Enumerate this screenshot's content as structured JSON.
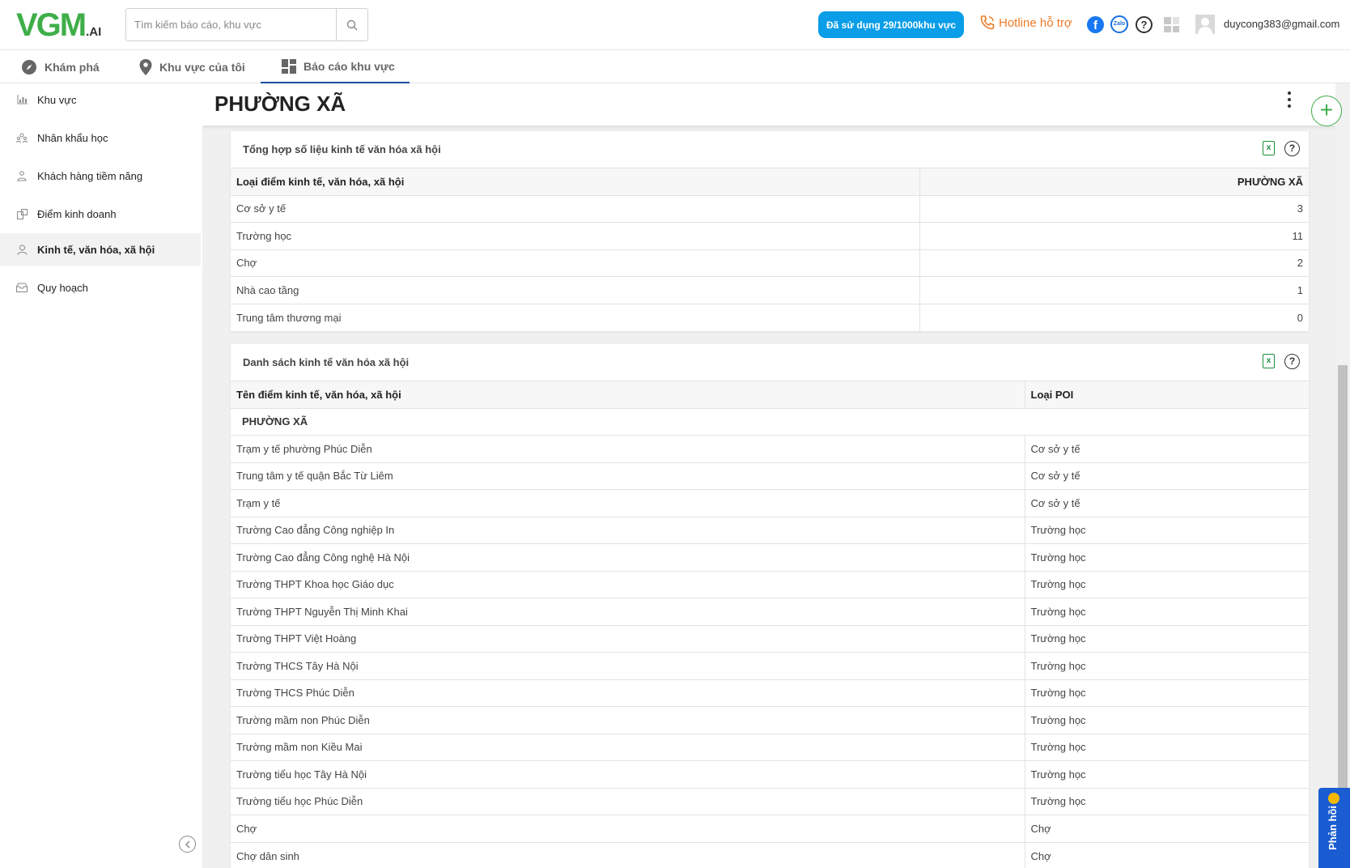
{
  "header": {
    "logo_text": "VGM",
    "logo_suffix": ".AI",
    "search_placeholder": "Tìm kiếm báo cáo, khu vực",
    "usage_badge": "Đã sử dụng 29/1000khu vực",
    "hotline": "Hotline hỗ trợ",
    "zalo_label": "Zalo",
    "help_glyph": "?",
    "user_email": "duycong383@gmail.com"
  },
  "nav": {
    "tabs": [
      {
        "label": "Khám phá",
        "icon": "compass-icon"
      },
      {
        "label": "Khu vực của tôi",
        "icon": "map-pin-icon"
      },
      {
        "label": "Báo cáo khu vực",
        "icon": "dashboard-icon",
        "active": true
      }
    ]
  },
  "sidebar": {
    "items": [
      {
        "label": "Khu vực",
        "icon": "bar-chart-icon"
      },
      {
        "label": "Nhân khẩu học",
        "icon": "people-icon"
      },
      {
        "label": "Khách hàng tiềm năng",
        "icon": "customer-icon"
      },
      {
        "label": "Điểm kinh doanh",
        "icon": "store-icon"
      },
      {
        "label": "Kinh tế, văn hóa, xã hội",
        "icon": "culture-icon",
        "active": true
      },
      {
        "label": "Quy hoạch",
        "icon": "planning-icon"
      }
    ]
  },
  "main": {
    "page_title": "PHƯỜNG XÃ",
    "summary": {
      "title": "Tổng hợp số liệu kinh tế văn hóa xã hội",
      "col_type": "Loại điểm kinh tế, văn hóa, xã hội",
      "col_area": "PHƯỜNG XÃ",
      "rows": [
        {
          "type": "Cơ sở y tế",
          "value": "3"
        },
        {
          "type": "Trường học",
          "value": "11"
        },
        {
          "type": "Chợ",
          "value": "2"
        },
        {
          "type": "Nhà cao tầng",
          "value": "1"
        },
        {
          "type": "Trung tâm thương mại",
          "value": "0"
        }
      ]
    },
    "list": {
      "title": "Danh sách kinh tế văn hóa xã hội",
      "col_name": "Tên điểm kinh tế, văn hóa, xã hội",
      "col_poi": "Loại POI",
      "group": "PHƯỜNG XÃ",
      "rows": [
        {
          "name": "Trạm y tế phường Phúc Diễn",
          "poi": "Cơ sở y tế"
        },
        {
          "name": "Trung tâm y tế quận Bắc Từ Liêm",
          "poi": "Cơ sở y tế"
        },
        {
          "name": "Trạm y tế",
          "poi": "Cơ sở y tế"
        },
        {
          "name": "Trường Cao đẳng Công nghiệp In",
          "poi": "Trường học"
        },
        {
          "name": "Trường Cao đẳng Công nghệ Hà Nội",
          "poi": "Trường học"
        },
        {
          "name": "Trường THPT Khoa học Giáo dục",
          "poi": "Trường học"
        },
        {
          "name": "Trường THPT Nguyễn Thị Minh Khai",
          "poi": "Trường học"
        },
        {
          "name": "Trường THPT Việt Hoàng",
          "poi": "Trường học"
        },
        {
          "name": "Trường THCS Tây Hà Nội",
          "poi": "Trường học"
        },
        {
          "name": "Trường THCS Phúc Diễn",
          "poi": "Trường học"
        },
        {
          "name": "Trường mầm non Phúc Diễn",
          "poi": "Trường học"
        },
        {
          "name": "Trường mầm non Kiều Mai",
          "poi": "Trường học"
        },
        {
          "name": "Trường tiểu học Tây Hà Nội",
          "poi": "Trường học"
        },
        {
          "name": "Trường tiểu học Phúc Diễn",
          "poi": "Trường học"
        },
        {
          "name": "Chợ",
          "poi": "Chợ"
        },
        {
          "name": "Chợ dân sinh",
          "poi": "Chợ"
        }
      ]
    }
  },
  "feedback": {
    "label": "Phản hồi"
  },
  "colors": {
    "brand_green": "#3fae49",
    "brand_blue": "#1a7fc1",
    "badge_blue": "#0a9de8",
    "hotline_orange": "#ee7a27",
    "active_tab_underline": "#1f4e9c",
    "feedback_blue": "#1a5cd1"
  }
}
